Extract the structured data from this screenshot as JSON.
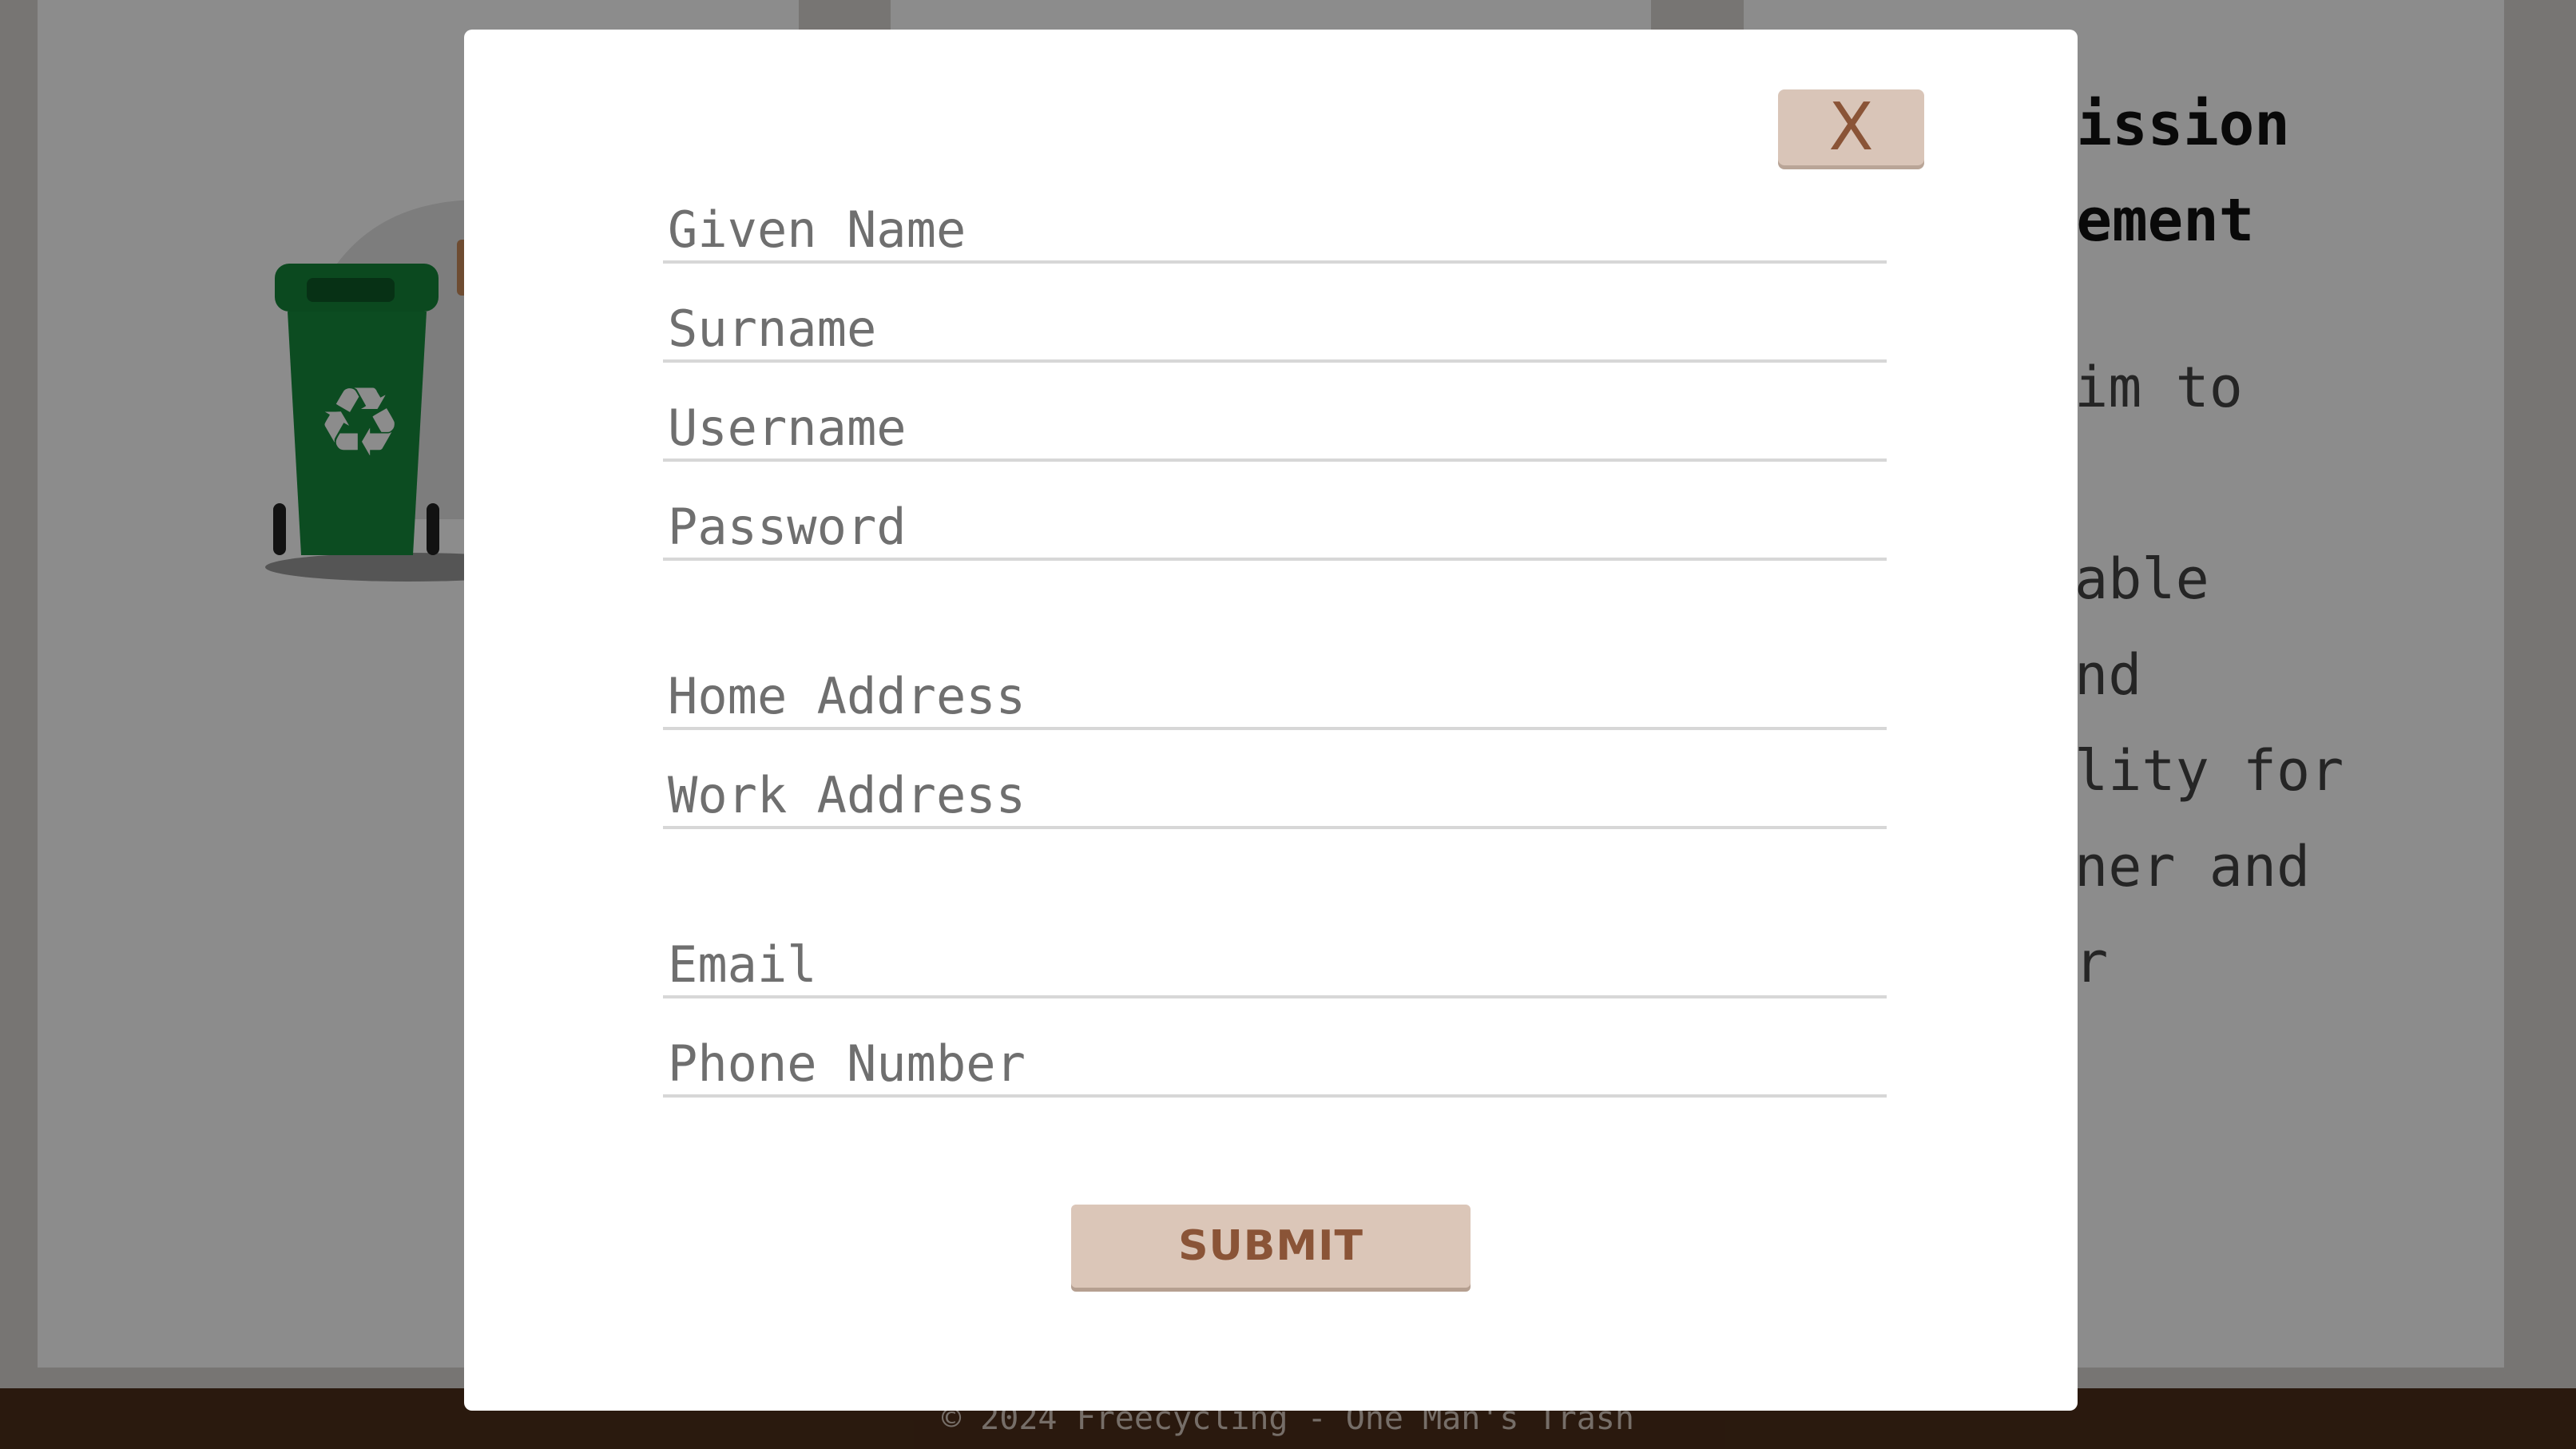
{
  "background_page": {
    "mission": {
      "title_lines": [
        "Mission",
        "tement"
      ],
      "text": "aim    to\nr\nnable\n       and\nility  for\nener   and\ner\n."
    },
    "footer_text": "© 2024 Freecycling - One Man's Trash"
  },
  "modal": {
    "close_label": "X",
    "fields": {
      "given_name": "Given Name",
      "surname": "Surname",
      "username": "Username",
      "password": "Password",
      "home_address": "Home Address",
      "work_address": "Work Address",
      "email": "Email",
      "phone_number": "Phone Number"
    },
    "submit_label": "SUBMIT"
  },
  "colors": {
    "accent_button": "#d9c5b8",
    "accent_text": "#8a5437",
    "footer_bg": "#4d2f1a"
  }
}
